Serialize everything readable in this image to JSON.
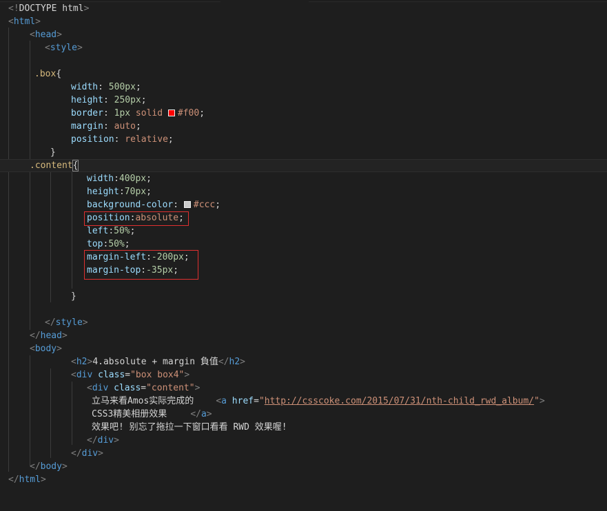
{
  "colors": {
    "red_swatch": "#ff0000",
    "gray_swatch": "#cccccc"
  },
  "lines": {
    "l1": {
      "a": "<!",
      "b": "DOCTYPE html",
      ">": ">"
    },
    "l2": {
      "a": "<",
      "b": "html",
      ">": ">"
    },
    "l3": {
      "a": "<",
      "b": "head",
      ">": ">"
    },
    "l4": {
      "a": "<",
      "b": "style",
      ">": ">"
    },
    "l6": {
      "sel": ".box",
      "p": "{"
    },
    "l7": {
      "prop": "width",
      "c": ": ",
      "val": "500px",
      "s": ";"
    },
    "l8": {
      "prop": "height",
      "c": ": ",
      "val": "250px",
      "s": ";"
    },
    "l9": {
      "prop": "border",
      "c": ": ",
      "v1": "1px",
      "v2": " solid ",
      "v3": "#f00",
      "s": ";"
    },
    "l10": {
      "prop": "margin",
      "c": ": ",
      "val": "auto",
      "s": ";"
    },
    "l11": {
      "prop": "position",
      "c": ": ",
      "val": "relative",
      "s": ";"
    },
    "l12": {
      "p": "}"
    },
    "l13": {
      "sel": ".content",
      "p": "{"
    },
    "l14": {
      "prop": "width",
      "c": ":",
      "val": "400px",
      "s": ";"
    },
    "l15": {
      "prop": "height",
      "c": ":",
      "val": "70px",
      "s": ";"
    },
    "l16": {
      "prop": "background-color",
      "c": ": ",
      "val": "#ccc",
      "s": ";"
    },
    "l17": {
      "prop": "position",
      "c": ":",
      "val": "absolute",
      "s": ";"
    },
    "l18": {
      "prop": "left",
      "c": ":",
      "val": "50%",
      "s": ";"
    },
    "l19": {
      "prop": "top",
      "c": ":",
      "val": "50%",
      "s": ";"
    },
    "l20": {
      "prop": "margin-left",
      "c": ":",
      "val": "-200px",
      "s": ";"
    },
    "l21": {
      "prop": "margin-top",
      "c": ":",
      "val": "-35px",
      "s": ";"
    },
    "l23": {
      "p": "}"
    },
    "l25": {
      "a": "</",
      "b": "style",
      ">": ">"
    },
    "l26": {
      "a": "</",
      "b": "head",
      ">": ">"
    },
    "l27": {
      "a": "<",
      "b": "body",
      ">": ">"
    },
    "l28": {
      "a": "<",
      "b": "h2",
      ">": ">",
      "text": "4.absolute + margin 負值",
      "a2": "</",
      "b2": "h2",
      ">2": ">"
    },
    "l29": {
      "a": "<",
      "b": "div",
      "attr": " class",
      "eq": "=",
      "str": "\"box box4\"",
      ">": ">"
    },
    "l30": {
      "a": "<",
      "b": "div",
      "attr": " class",
      "eq": "=",
      "str": "\"content\"",
      ">": ">"
    },
    "l31": {
      "text": "立马来看Amos实际完成的",
      "a": "<",
      "b": "a",
      "attr": " href",
      "eq": "=",
      "q1": "\"",
      "url": "http://csscoke.com/2015/07/31/nth-child_rwd_album/",
      "q2": "\"",
      ">": ">"
    },
    "l32": {
      "text": "CSS3精美相册效果",
      "a": "</",
      "b": "a",
      ">": ">"
    },
    "l33": {
      "text": "效果吧! 别忘了拖拉一下窗口看看 RWD 效果喔!"
    },
    "l34": {
      "a": "</",
      "b": "div",
      ">": ">"
    },
    "l35": {
      "a": "</",
      "b": "div",
      ">": ">"
    },
    "l36": {
      "a": "</",
      "b": "body",
      ">": ">"
    },
    "l37": {
      "a": "</",
      "b": "html",
      ">": ">"
    }
  }
}
